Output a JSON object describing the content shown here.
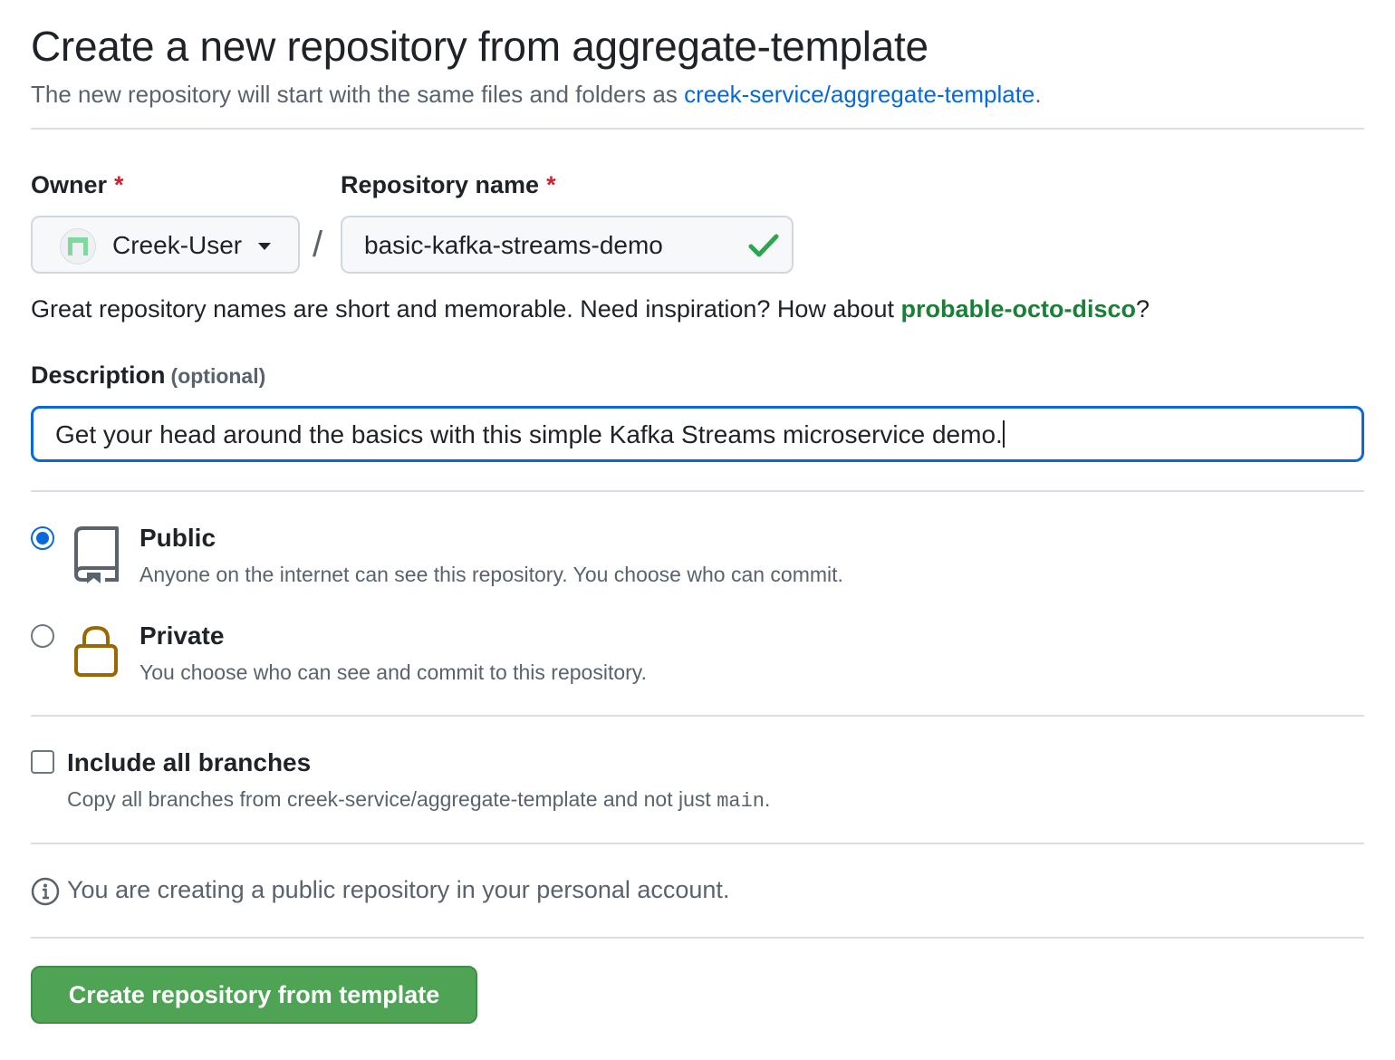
{
  "page": {
    "title": "Create a new repository from aggregate-template",
    "subtitle_prefix": "The new repository will start with the same files and folders as ",
    "template_link": "creek-service/aggregate-template",
    "subtitle_suffix": "."
  },
  "owner": {
    "label": "Owner",
    "required_mark": "*",
    "selected": "Creek-User"
  },
  "repo_name": {
    "label": "Repository name",
    "required_mark": "*",
    "value": "basic-kafka-streams-demo",
    "separator": "/"
  },
  "hint": {
    "prefix": "Great repository names are short and memorable. Need inspiration? How about ",
    "suggestion": "probable-octo-disco",
    "suffix": "?"
  },
  "description": {
    "label": "Description",
    "optional": "(optional)",
    "value": "Get your head around the basics with this simple Kafka Streams microservice demo."
  },
  "visibility": {
    "public": {
      "title": "Public",
      "desc": "Anyone on the internet can see this repository. You choose who can commit.",
      "selected": true
    },
    "private": {
      "title": "Private",
      "desc": "You choose who can see and commit to this repository.",
      "selected": false
    }
  },
  "branches": {
    "title": "Include all branches",
    "desc_prefix": "Copy all branches from creek-service/aggregate-template and not just ",
    "branch": "main",
    "desc_suffix": ".",
    "checked": false
  },
  "info": {
    "text": "You are creating a public repository in your personal account."
  },
  "submit": {
    "label": "Create repository from template"
  },
  "colors": {
    "link": "#0969da",
    "suggestion": "#1a7f37",
    "required": "#cf222e",
    "submit_bg": "#4fa355",
    "lock": "#9a6700",
    "avatar": "#7ed9a0"
  }
}
